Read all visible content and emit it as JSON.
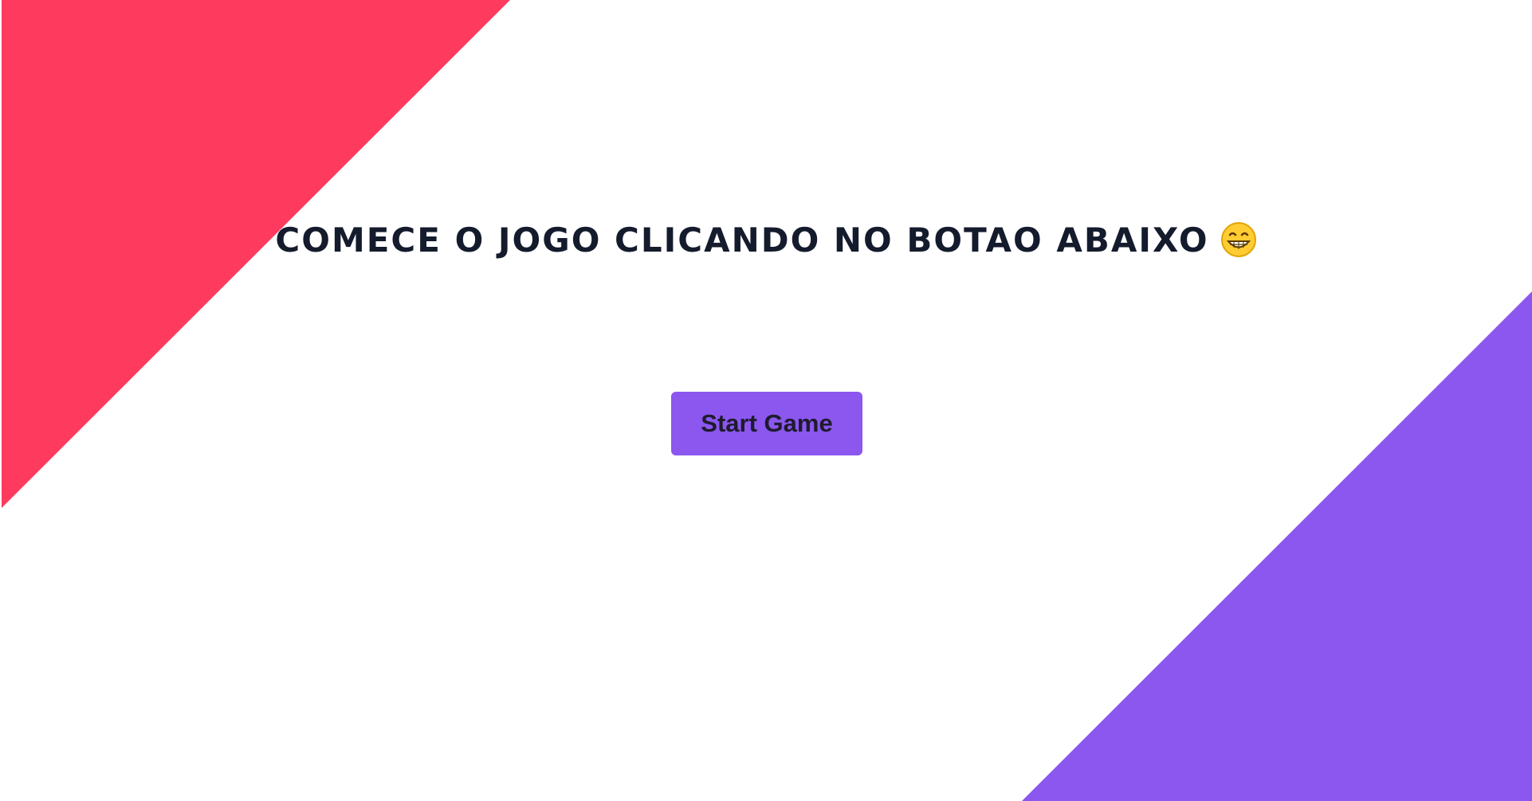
{
  "colors": {
    "background": "#ffffff",
    "left_triangle": "#ff3a5f",
    "right_triangle": "#8b57ee",
    "title_text": "#141b2c",
    "button_bg": "#8b57ee",
    "button_text": "#1e1b2e"
  },
  "header": {
    "title": "COMECE O JOGO CLICANDO NO BOTAO ABAIXO",
    "emoji_icon": "grinning-face-icon"
  },
  "start_button": {
    "label": "Start Game"
  }
}
